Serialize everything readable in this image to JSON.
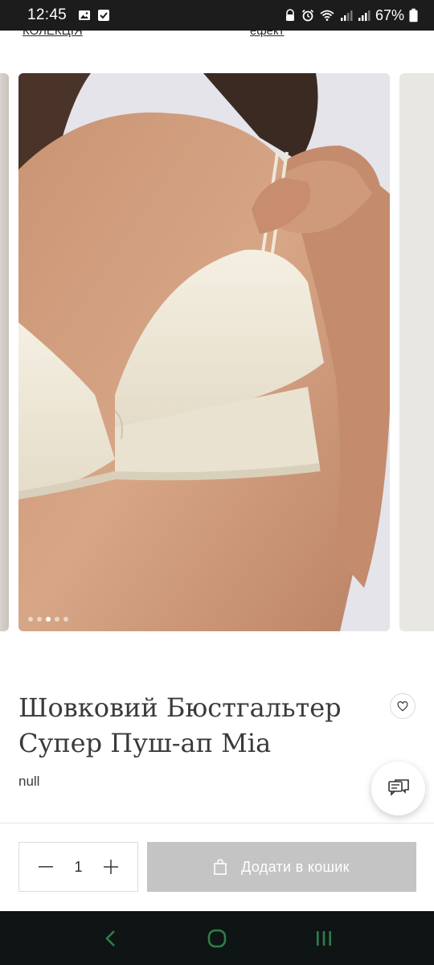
{
  "status_bar": {
    "time": "12:45",
    "battery": "67%",
    "icons_left": [
      "gallery-icon",
      "checkbox-icon"
    ],
    "icons_right": [
      "alarm-lock-icon",
      "alarm-icon",
      "wifi-icon",
      "signal-icon",
      "signal-icon",
      "battery-icon"
    ]
  },
  "top_links": {
    "left": "КОЛЕКЦІЯ",
    "right": "ефект"
  },
  "gallery": {
    "slide_count": 5,
    "active_index": 2
  },
  "product": {
    "title": "Шовковий Бюстгальтер Супер Пуш-ап Mia",
    "subtitle": "null"
  },
  "purchase": {
    "quantity": "1",
    "add_to_cart_label": "Додати в кошик"
  },
  "colors": {
    "status_bar_bg": "#1c1c1c",
    "nav_bar_bg": "#0f1514",
    "nav_icon": "#2f7d4a",
    "button_disabled_bg": "#c4c4c4"
  }
}
